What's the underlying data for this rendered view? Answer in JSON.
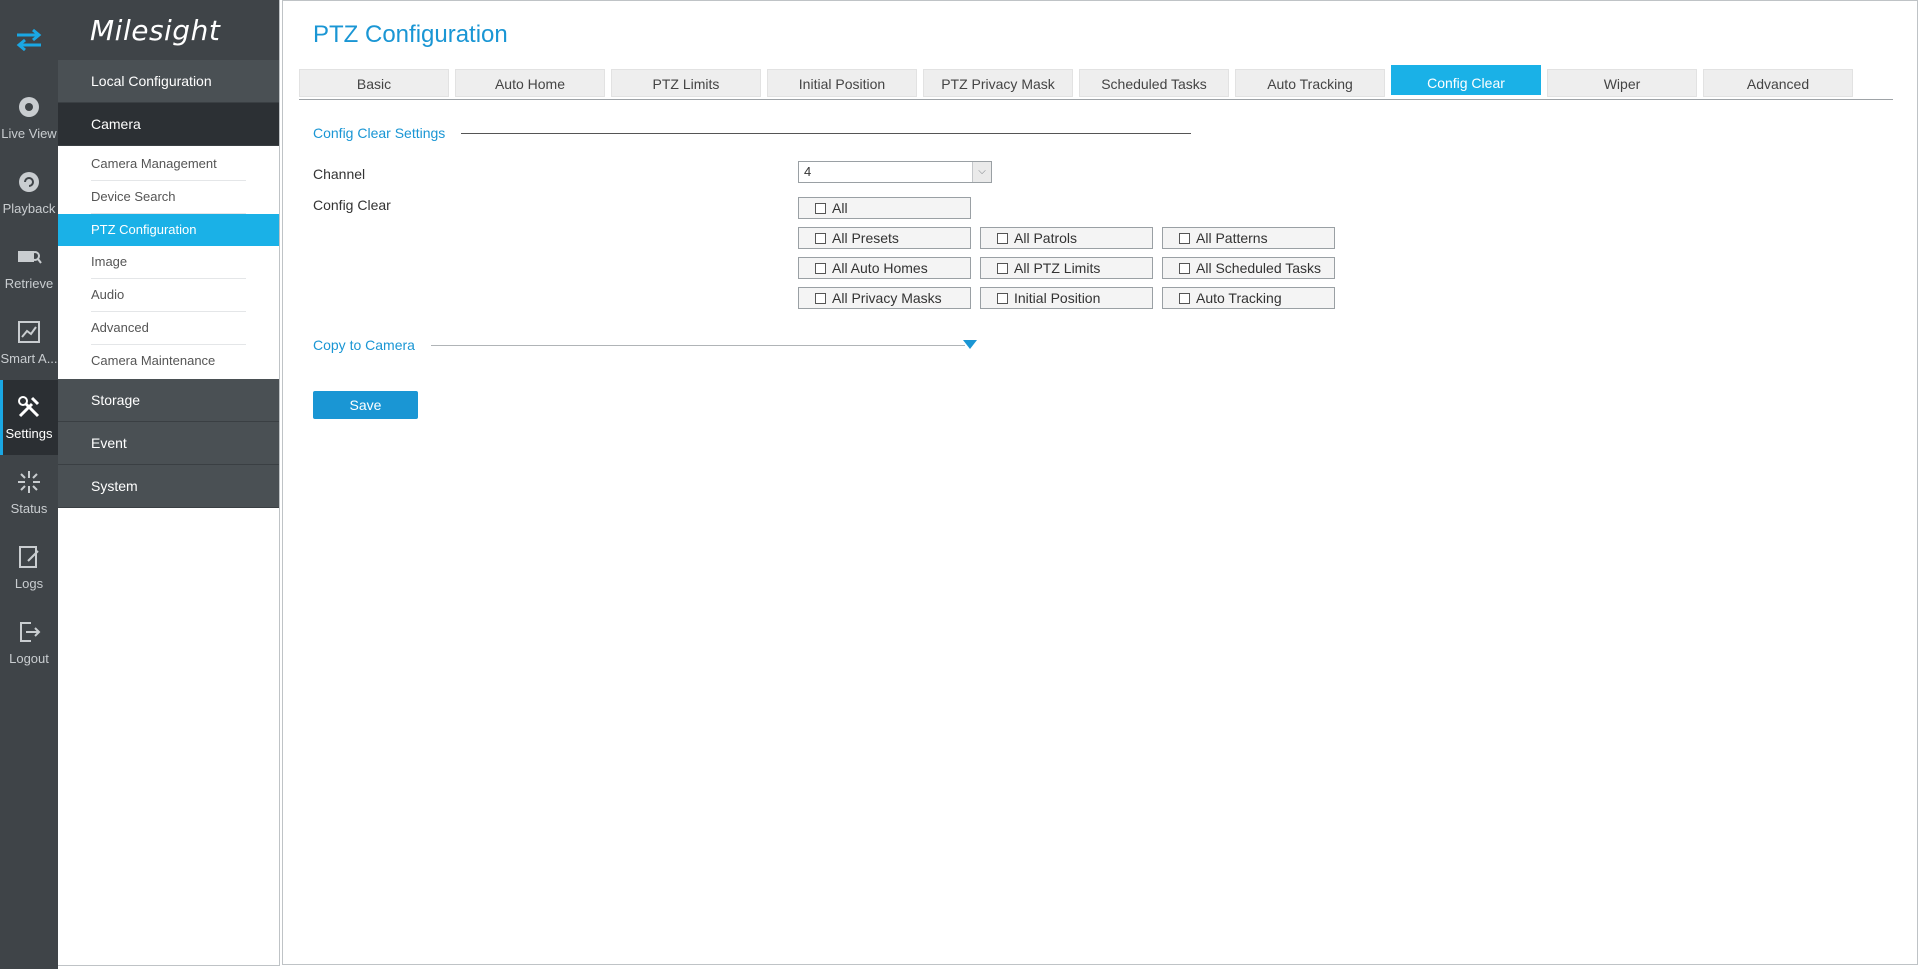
{
  "rail": {
    "items": [
      {
        "label": "Live View",
        "icon": "live-view-icon"
      },
      {
        "label": "Playback",
        "icon": "playback-icon"
      },
      {
        "label": "Retrieve",
        "icon": "retrieve-icon"
      },
      {
        "label": "Smart A...",
        "icon": "smart-analytics-icon"
      },
      {
        "label": "Settings",
        "icon": "settings-icon",
        "active": true
      },
      {
        "label": "Status",
        "icon": "status-icon"
      },
      {
        "label": "Logs",
        "icon": "logs-icon"
      },
      {
        "label": "Logout",
        "icon": "logout-icon"
      }
    ]
  },
  "menu": {
    "logo": "Milesight",
    "groups": {
      "local": "Local Configuration",
      "camera": "Camera",
      "storage": "Storage",
      "event": "Event",
      "system": "System"
    },
    "camera_items": [
      "Camera Management",
      "Device Search",
      "PTZ Configuration",
      "Image",
      "Audio",
      "Advanced",
      "Camera Maintenance"
    ]
  },
  "page": {
    "title": "PTZ Configuration",
    "tabs": [
      "Basic",
      "Auto Home",
      "PTZ Limits",
      "Initial Position",
      "PTZ Privacy Mask",
      "Scheduled Tasks",
      "Auto Tracking",
      "Config Clear",
      "Wiper",
      "Advanced"
    ],
    "active_tab": "Config Clear",
    "section_title": "Config Clear Settings",
    "channel_label": "Channel",
    "channel_value": "4",
    "config_clear_label": "Config Clear",
    "checkboxes": {
      "all": "All",
      "all_presets": "All Presets",
      "all_patrols": "All Patrols",
      "all_patterns": "All Patterns",
      "all_auto_homes": "All Auto Homes",
      "all_ptz_limits": "All PTZ Limits",
      "all_scheduled_tasks": "All Scheduled Tasks",
      "all_privacy_masks": "All Privacy Masks",
      "initial_position": "Initial Position",
      "auto_tracking": "Auto Tracking"
    },
    "copy_to_camera": "Copy to Camera",
    "save": "Save"
  },
  "colors": {
    "accent": "#1ab1e7",
    "title_blue": "#1a96d4",
    "rail_bg": "#3f4448",
    "menu_dark": "#2c3034"
  }
}
